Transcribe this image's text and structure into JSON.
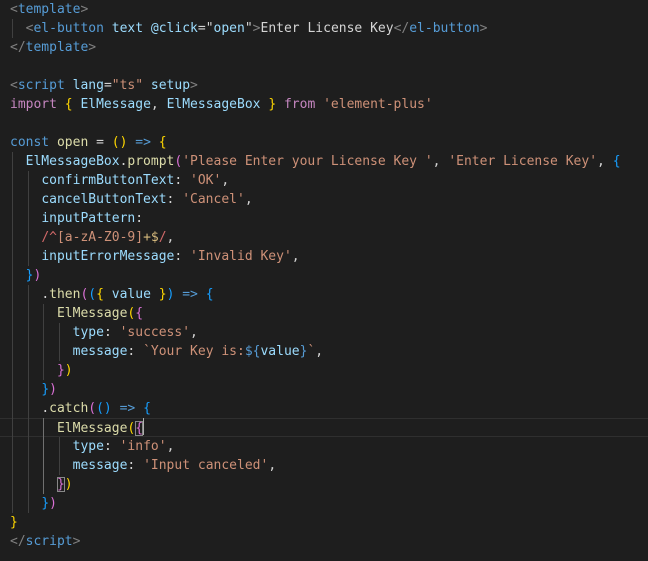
{
  "editor": {
    "colors": {
      "background": "#1e1e1e",
      "tag_bracket": "#808080",
      "tag": "#569cd6",
      "attribute": "#9cdcfe",
      "string": "#ce9178",
      "keyword": "#569cd6",
      "control_keyword": "#c586c0",
      "variable": "#9cdcfe",
      "function": "#dcdcaa",
      "class": "#4ec9b0",
      "text": "#d4d4d4",
      "regex": "#d16969",
      "bracket_gold": "#ffd700",
      "bracket_pink": "#da70d6",
      "bracket_blue": "#179fff"
    },
    "lines": [
      {
        "indent": 0,
        "tokens": [
          [
            "<",
            "#808080"
          ],
          [
            "template",
            "#569cd6"
          ],
          [
            ">",
            "#808080"
          ]
        ]
      },
      {
        "indent": 1,
        "tokens": [
          [
            "<",
            "#808080"
          ],
          [
            "el-button",
            "#569cd6"
          ],
          [
            " ",
            "#d4d4d4"
          ],
          [
            "text",
            "#9cdcfe"
          ],
          [
            " ",
            "#d4d4d4"
          ],
          [
            "@click",
            "#9cdcfe"
          ],
          [
            "=",
            "#d4d4d4"
          ],
          [
            "\"",
            "#d4d4d4"
          ],
          [
            "open",
            "#9cdcfe"
          ],
          [
            "\"",
            "#d4d4d4"
          ],
          [
            ">",
            "#808080"
          ],
          [
            "Enter License Key",
            "#d4d4d4"
          ],
          [
            "</",
            "#808080"
          ],
          [
            "el-button",
            "#569cd6"
          ],
          [
            ">",
            "#808080"
          ]
        ]
      },
      {
        "indent": 0,
        "tokens": [
          [
            "</",
            "#808080"
          ],
          [
            "template",
            "#569cd6"
          ],
          [
            ">",
            "#808080"
          ]
        ]
      },
      {
        "indent": 0,
        "tokens": []
      },
      {
        "indent": 0,
        "tokens": [
          [
            "<",
            "#808080"
          ],
          [
            "script",
            "#569cd6"
          ],
          [
            " ",
            "#d4d4d4"
          ],
          [
            "lang",
            "#9cdcfe"
          ],
          [
            "=",
            "#d4d4d4"
          ],
          [
            "\"ts\"",
            "#ce9178"
          ],
          [
            " ",
            "#d4d4d4"
          ],
          [
            "setup",
            "#9cdcfe"
          ],
          [
            ">",
            "#808080"
          ]
        ]
      },
      {
        "indent": 0,
        "tokens": [
          [
            "import",
            "#c586c0"
          ],
          [
            " ",
            "#d4d4d4"
          ],
          [
            "{",
            "#ffd700"
          ],
          [
            " ",
            "#d4d4d4"
          ],
          [
            "ElMessage",
            "#9cdcfe"
          ],
          [
            ", ",
            "#d4d4d4"
          ],
          [
            "ElMessageBox",
            "#9cdcfe"
          ],
          [
            " ",
            "#d4d4d4"
          ],
          [
            "}",
            "#ffd700"
          ],
          [
            " ",
            "#d4d4d4"
          ],
          [
            "from",
            "#c586c0"
          ],
          [
            " ",
            "#d4d4d4"
          ],
          [
            "'element-plus'",
            "#ce9178"
          ]
        ]
      },
      {
        "indent": 0,
        "tokens": []
      },
      {
        "indent": 0,
        "tokens": [
          [
            "const",
            "#569cd6"
          ],
          [
            " ",
            "#d4d4d4"
          ],
          [
            "open",
            "#dcdcaa"
          ],
          [
            " ",
            "#d4d4d4"
          ],
          [
            "=",
            "#d4d4d4"
          ],
          [
            " ",
            "#d4d4d4"
          ],
          [
            "()",
            "#ffd700"
          ],
          [
            " ",
            "#d4d4d4"
          ],
          [
            "=>",
            "#569cd6"
          ],
          [
            " ",
            "#d4d4d4"
          ],
          [
            "{",
            "#ffd700"
          ]
        ]
      },
      {
        "indent": 1,
        "tokens": [
          [
            "ElMessageBox",
            "#9cdcfe"
          ],
          [
            ".",
            "#d4d4d4"
          ],
          [
            "prompt",
            "#dcdcaa"
          ],
          [
            "(",
            "#da70d6"
          ],
          [
            "'Please Enter your License Key '",
            "#ce9178"
          ],
          [
            ", ",
            "#d4d4d4"
          ],
          [
            "'Enter License Key'",
            "#ce9178"
          ],
          [
            ", ",
            "#d4d4d4"
          ],
          [
            "{",
            "#179fff"
          ]
        ]
      },
      {
        "indent": 2,
        "tokens": [
          [
            "confirmButtonText",
            "#9cdcfe"
          ],
          [
            ": ",
            "#d4d4d4"
          ],
          [
            "'OK'",
            "#ce9178"
          ],
          [
            ",",
            "#d4d4d4"
          ]
        ]
      },
      {
        "indent": 2,
        "tokens": [
          [
            "cancelButtonText",
            "#9cdcfe"
          ],
          [
            ": ",
            "#d4d4d4"
          ],
          [
            "'Cancel'",
            "#ce9178"
          ],
          [
            ",",
            "#d4d4d4"
          ]
        ]
      },
      {
        "indent": 2,
        "tokens": [
          [
            "inputPattern",
            "#9cdcfe"
          ],
          [
            ":",
            "#d4d4d4"
          ]
        ]
      },
      {
        "indent": 2,
        "tokens": [
          [
            "/^",
            "#d16969"
          ],
          [
            "[a-zA-Z0-9]",
            "#ce9178"
          ],
          [
            "+$",
            "#d7ba7d"
          ],
          [
            "/",
            "#d16969"
          ],
          [
            ",",
            "#d4d4d4"
          ]
        ]
      },
      {
        "indent": 2,
        "tokens": [
          [
            "inputErrorMessage",
            "#9cdcfe"
          ],
          [
            ": ",
            "#d4d4d4"
          ],
          [
            "'Invalid Key'",
            "#ce9178"
          ],
          [
            ",",
            "#d4d4d4"
          ]
        ]
      },
      {
        "indent": 1,
        "tokens": [
          [
            "}",
            "#179fff"
          ],
          [
            ")",
            "#da70d6"
          ]
        ]
      },
      {
        "indent": 2,
        "tokens": [
          [
            ".",
            "#d4d4d4"
          ],
          [
            "then",
            "#dcdcaa"
          ],
          [
            "(",
            "#da70d6"
          ],
          [
            "(",
            "#179fff"
          ],
          [
            "{",
            "#ffd700"
          ],
          [
            " ",
            "#d4d4d4"
          ],
          [
            "value",
            "#9cdcfe"
          ],
          [
            " ",
            "#d4d4d4"
          ],
          [
            "}",
            "#ffd700"
          ],
          [
            ")",
            "#179fff"
          ],
          [
            " ",
            "#d4d4d4"
          ],
          [
            "=>",
            "#569cd6"
          ],
          [
            " ",
            "#d4d4d4"
          ],
          [
            "{",
            "#179fff"
          ]
        ]
      },
      {
        "indent": 3,
        "tokens": [
          [
            "ElMessage",
            "#dcdcaa"
          ],
          [
            "(",
            "#ffd700"
          ],
          [
            "{",
            "#da70d6"
          ]
        ]
      },
      {
        "indent": 4,
        "tokens": [
          [
            "type",
            "#9cdcfe"
          ],
          [
            ": ",
            "#d4d4d4"
          ],
          [
            "'success'",
            "#ce9178"
          ],
          [
            ",",
            "#d4d4d4"
          ]
        ]
      },
      {
        "indent": 4,
        "tokens": [
          [
            "message",
            "#9cdcfe"
          ],
          [
            ": ",
            "#d4d4d4"
          ],
          [
            "`Your Key is:",
            "#ce9178"
          ],
          [
            "${",
            "#569cd6"
          ],
          [
            "value",
            "#9cdcfe"
          ],
          [
            "}",
            "#569cd6"
          ],
          [
            "`",
            "#ce9178"
          ],
          [
            ",",
            "#d4d4d4"
          ]
        ]
      },
      {
        "indent": 3,
        "tokens": [
          [
            "}",
            "#da70d6"
          ],
          [
            ")",
            "#ffd700"
          ]
        ]
      },
      {
        "indent": 2,
        "tokens": [
          [
            "}",
            "#179fff"
          ],
          [
            ")",
            "#da70d6"
          ]
        ]
      },
      {
        "indent": 2,
        "tokens": [
          [
            ".",
            "#d4d4d4"
          ],
          [
            "catch",
            "#dcdcaa"
          ],
          [
            "(",
            "#da70d6"
          ],
          [
            "()",
            "#179fff"
          ],
          [
            " ",
            "#d4d4d4"
          ],
          [
            "=>",
            "#569cd6"
          ],
          [
            " ",
            "#d4d4d4"
          ],
          [
            "{",
            "#179fff"
          ]
        ]
      },
      {
        "indent": 3,
        "current": true,
        "tokens": [
          [
            "ElMessage",
            "#dcdcaa"
          ],
          [
            "(",
            "#ffd700"
          ],
          [
            "{",
            "#da70d6",
            "bm"
          ],
          [
            "|cursor|",
            ""
          ]
        ]
      },
      {
        "indent": 4,
        "tokens": [
          [
            "type",
            "#9cdcfe"
          ],
          [
            ": ",
            "#d4d4d4"
          ],
          [
            "'info'",
            "#ce9178"
          ],
          [
            ",",
            "#d4d4d4"
          ]
        ]
      },
      {
        "indent": 4,
        "tokens": [
          [
            "message",
            "#9cdcfe"
          ],
          [
            ": ",
            "#d4d4d4"
          ],
          [
            "'Input canceled'",
            "#ce9178"
          ],
          [
            ",",
            "#d4d4d4"
          ]
        ]
      },
      {
        "indent": 3,
        "tokens": [
          [
            "}",
            "#da70d6",
            "bm"
          ],
          [
            ")",
            "#ffd700"
          ]
        ]
      },
      {
        "indent": 2,
        "tokens": [
          [
            "}",
            "#179fff"
          ],
          [
            ")",
            "#da70d6"
          ]
        ]
      },
      {
        "indent": 0,
        "tokens": [
          [
            "}",
            "#ffd700"
          ]
        ]
      },
      {
        "indent": 0,
        "tokens": [
          [
            "</",
            "#808080"
          ],
          [
            "script",
            "#569cd6"
          ],
          [
            ">",
            "#808080"
          ]
        ]
      }
    ]
  }
}
